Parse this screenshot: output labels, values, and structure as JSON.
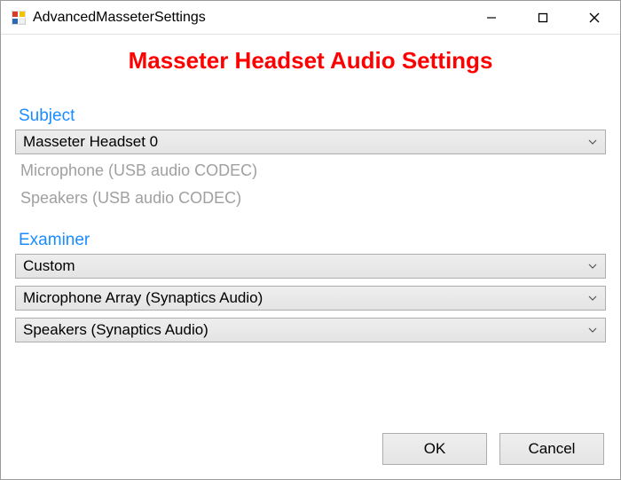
{
  "window": {
    "title": "AdvancedMasseterSettings"
  },
  "header": {
    "page_title": "Masseter Headset Audio Settings"
  },
  "subject": {
    "label": "Subject",
    "device_selected": "Masseter Headset 0",
    "microphone": "Microphone (USB audio CODEC)",
    "speakers": "Speakers (USB audio CODEC)"
  },
  "examiner": {
    "label": "Examiner",
    "device_selected": "Custom",
    "microphone_selected": "Microphone Array (Synaptics Audio)",
    "speakers_selected": "Speakers (Synaptics Audio)"
  },
  "buttons": {
    "ok": "OK",
    "cancel": "Cancel"
  }
}
